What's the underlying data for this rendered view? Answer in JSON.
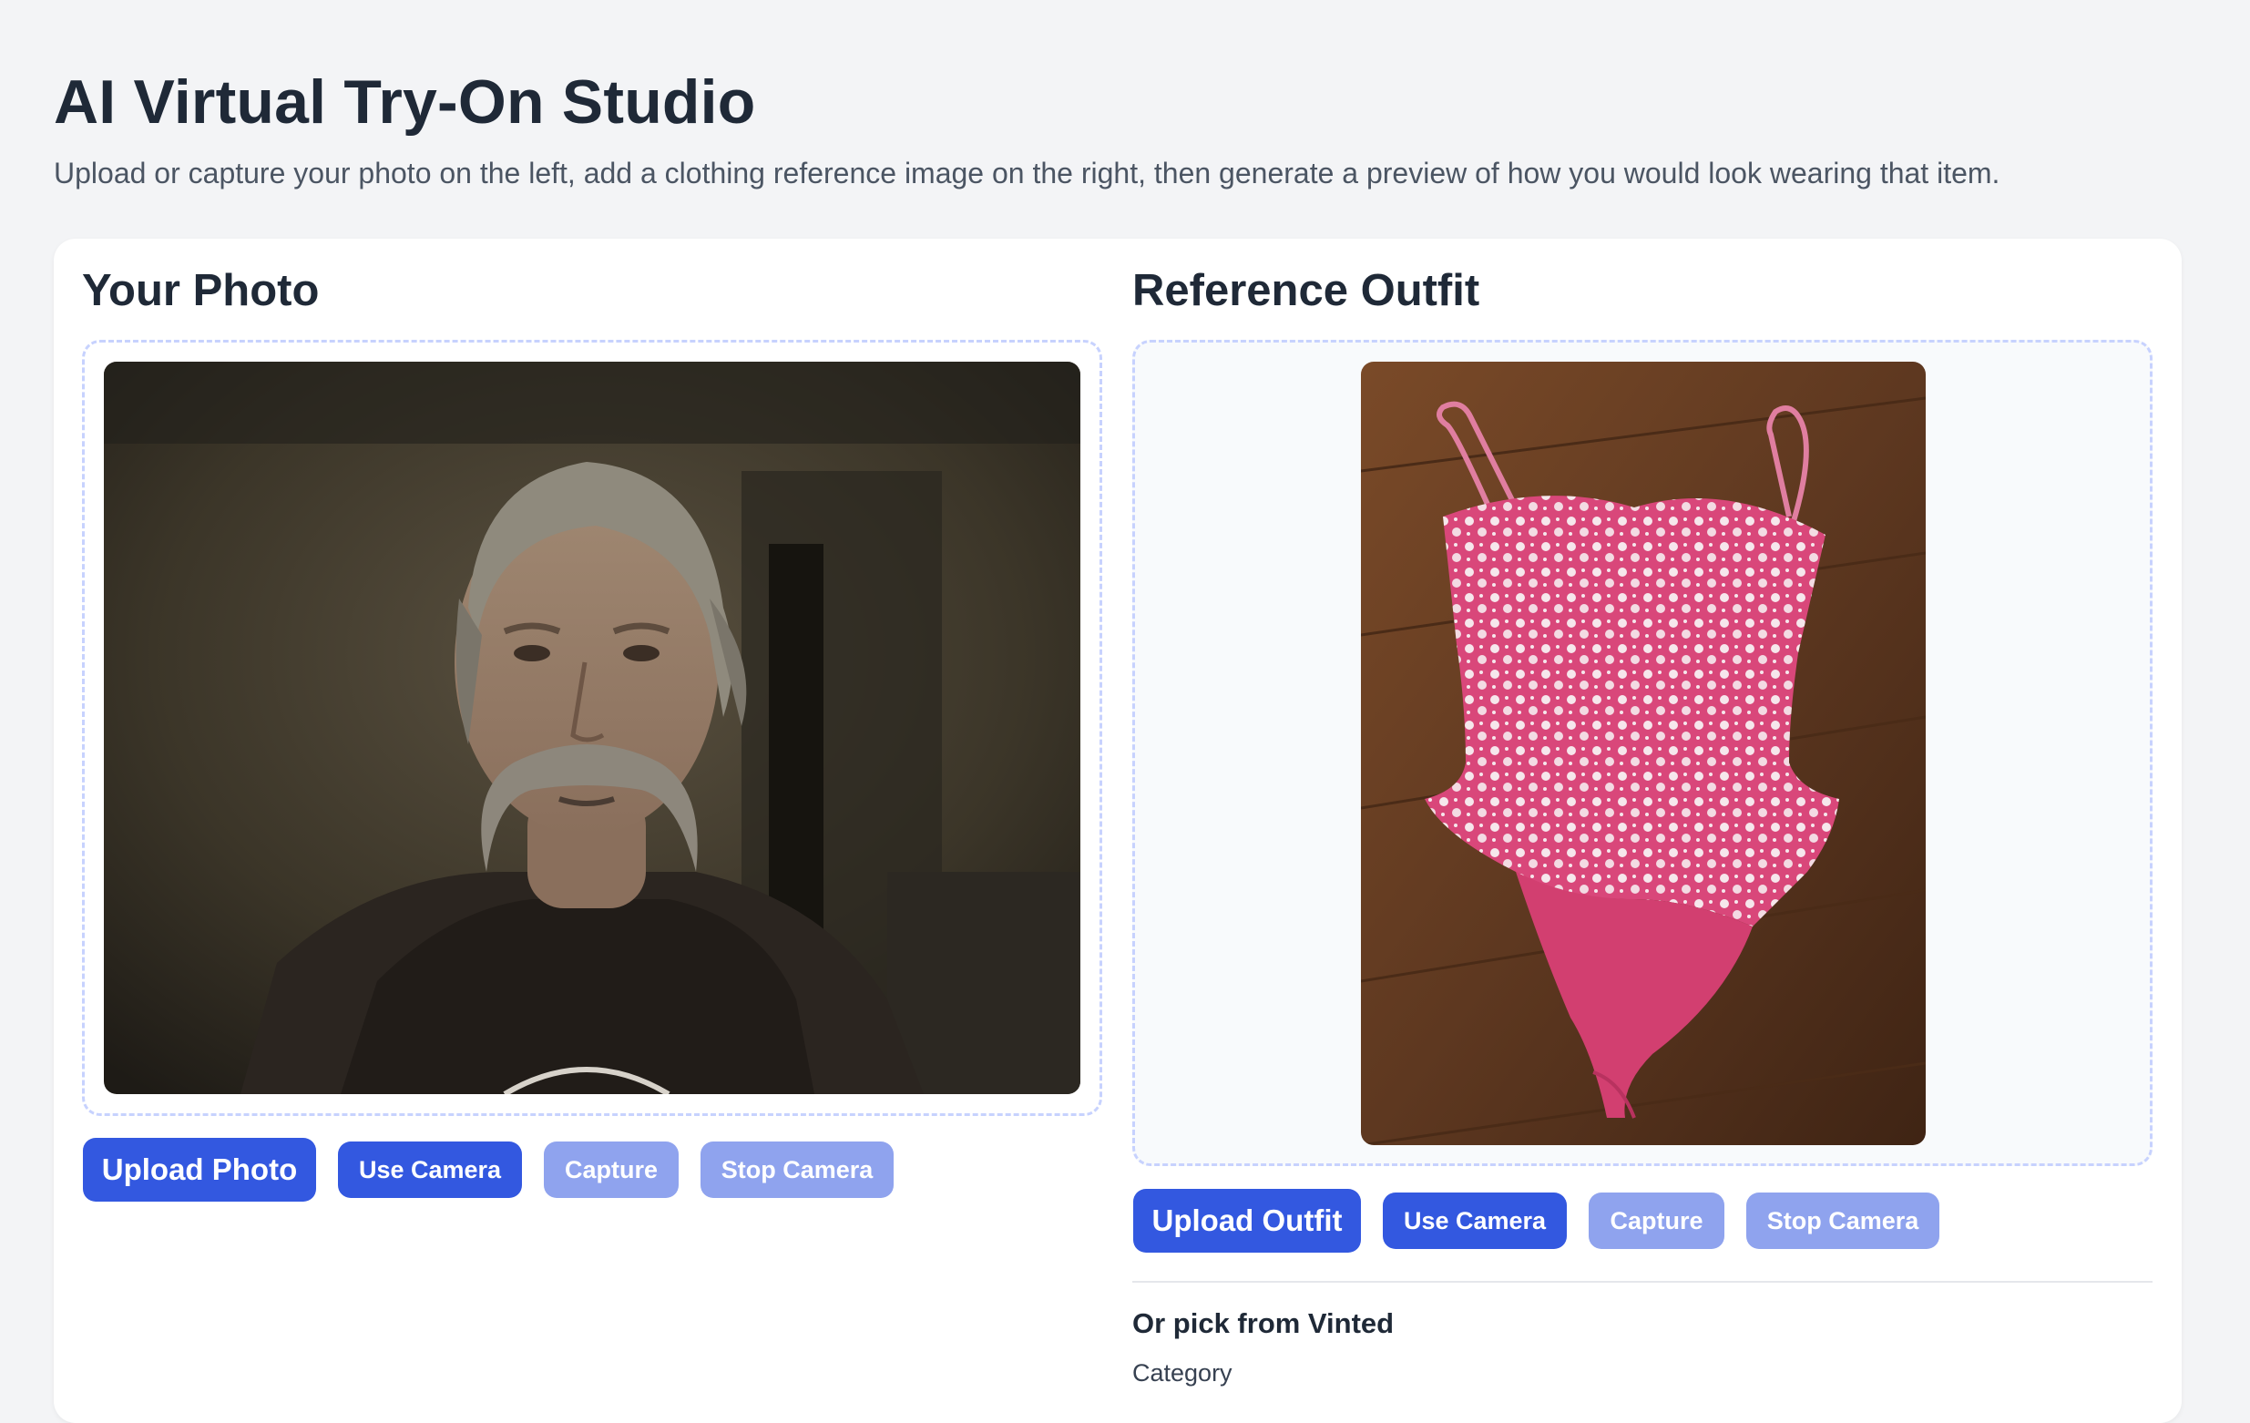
{
  "header": {
    "title": "AI Virtual Try-On Studio",
    "subtitle": "Upload or capture your photo on the left, add a clothing reference image on the right, then generate a preview of how you would look wearing that item."
  },
  "left_panel": {
    "title": "Your Photo",
    "buttons": {
      "upload": "Upload Photo",
      "use_camera": "Use Camera",
      "capture": "Capture",
      "stop_camera": "Stop Camera"
    }
  },
  "right_panel": {
    "title": "Reference Outfit",
    "buttons": {
      "upload": "Upload Outfit",
      "use_camera": "Use Camera",
      "capture": "Capture",
      "stop_camera": "Stop Camera"
    },
    "vinted": {
      "heading": "Or pick from Vinted",
      "category_label": "Category"
    }
  },
  "colors": {
    "primary_button": "#3358e0",
    "disabled_button": "#8fa3ee",
    "dropzone_border": "#c7d2fe",
    "page_bg": "#f3f4f6"
  }
}
